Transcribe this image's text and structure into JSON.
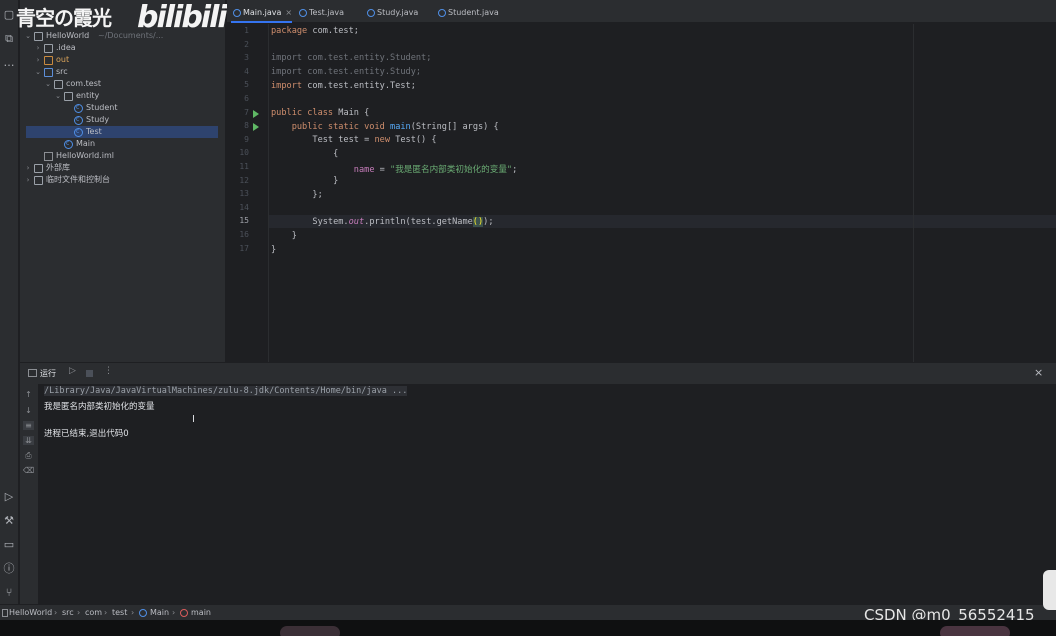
{
  "watermark": {
    "text": "青空の霞光",
    "logo": "bilibili"
  },
  "project_tree": [
    {
      "label": "HelloWorld",
      "suffix": "~/Documents/...",
      "type": "folder",
      "depth": 0,
      "expanded": true
    },
    {
      "label": ".idea",
      "type": "folder",
      "depth": 1,
      "expanded": false
    },
    {
      "label": "out",
      "type": "folder-orange",
      "depth": 1,
      "expanded": false
    },
    {
      "label": "src",
      "type": "folder-blue",
      "depth": 1,
      "expanded": true
    },
    {
      "label": "com.test",
      "type": "package",
      "depth": 2,
      "expanded": true
    },
    {
      "label": "entity",
      "type": "package",
      "depth": 3,
      "expanded": true
    },
    {
      "label": "Student",
      "type": "class",
      "depth": 4
    },
    {
      "label": "Study",
      "type": "class",
      "depth": 4
    },
    {
      "label": "Test",
      "type": "class",
      "depth": 4,
      "selected": true
    },
    {
      "label": "Main",
      "type": "class",
      "depth": 3
    },
    {
      "label": "HelloWorld.iml",
      "type": "file",
      "depth": 1
    },
    {
      "label": "外部库",
      "type": "lib",
      "depth": 0,
      "expanded": false
    },
    {
      "label": "临时文件和控制台",
      "type": "scratch",
      "depth": 0,
      "expanded": false
    }
  ],
  "tabs": [
    {
      "label": "Main.java",
      "active": true,
      "closable": true
    },
    {
      "label": "Test.java",
      "active": false
    },
    {
      "label": "Study.java",
      "active": false
    },
    {
      "label": "Student.java",
      "active": false
    }
  ],
  "editor": {
    "line_numbers": [
      "1",
      "2",
      "3",
      "4",
      "5",
      "6",
      "7",
      "8",
      "9",
      "10",
      "11",
      "12",
      "13",
      "14",
      "15",
      "16",
      "17"
    ],
    "current_line": "15",
    "run_marker_lines": [
      "7",
      "8"
    ]
  },
  "run_panel": {
    "title": "运行",
    "console": {
      "command": "/Library/Java/JavaVirtualMachines/zulu-8.jdk/Contents/Home/bin/java ...",
      "output": "我是匿名内部类初始化的变量",
      "exit": "进程已结束,退出代码0"
    }
  },
  "status_bar": {
    "breadcrumbs": [
      "HelloWorld",
      "src",
      "com",
      "test",
      "Main",
      "main"
    ]
  },
  "overlay": {
    "csdn": "CSDN @m0_56552415"
  },
  "colors": {
    "accent": "#3574f0",
    "bg": "#1e1f22",
    "panel": "#2b2d30",
    "keyword": "#cf8e6d",
    "string": "#6aab73"
  }
}
